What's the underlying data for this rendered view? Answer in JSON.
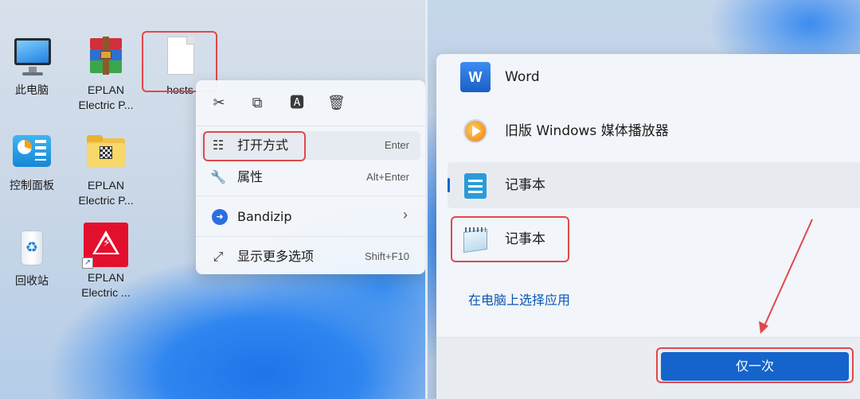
{
  "desktop": {
    "icons": [
      {
        "label": "此电脑"
      },
      {
        "label": "EPLAN\nElectric P..."
      },
      {
        "label": "hosts"
      },
      {
        "label": "控制面板"
      },
      {
        "label": "EPLAN\nElectric P..."
      },
      {
        "label": "回收站"
      },
      {
        "label": "EPLAN\nElectric ..."
      }
    ]
  },
  "context_menu": {
    "quick_actions": [
      "cut-icon",
      "copy-icon",
      "rename-icon",
      "delete-icon"
    ],
    "items": [
      {
        "label": "打开方式",
        "shortcut": "Enter",
        "icon": "open-with-icon"
      },
      {
        "label": "属性",
        "shortcut": "Alt+Enter",
        "icon": "wrench-icon"
      },
      {
        "label": "Bandizip",
        "shortcut": "",
        "icon": "bandizip-icon",
        "chevron": "›"
      },
      {
        "label": "显示更多选项",
        "shortcut": "Shift+F10",
        "icon": "more-options-icon"
      }
    ]
  },
  "open_with": {
    "apps": [
      {
        "label": "Word",
        "icon": "word-icon"
      },
      {
        "label": "旧版 Windows 媒体播放器",
        "icon": "media-player-icon"
      },
      {
        "label": "记事本",
        "icon": "notepad-modern-icon"
      },
      {
        "label": "记事本",
        "icon": "notepad-classic-icon"
      }
    ],
    "choose_app_link": "在电脑上选择应用",
    "once_button": "仅一次"
  },
  "colors": {
    "accent": "#1464cc",
    "highlight": "#e0484c"
  }
}
